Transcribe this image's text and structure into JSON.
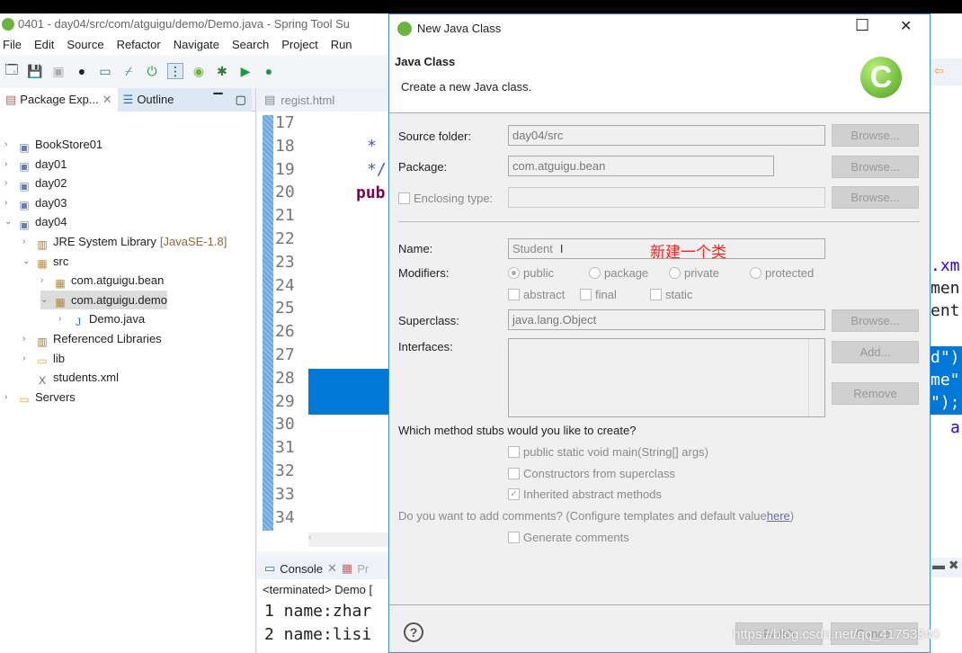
{
  "window": {
    "title": "0401 - day04/src/com/atguigu/demo/Demo.java - Spring Tool Su"
  },
  "menu": [
    "File",
    "Edit",
    "Source",
    "Refactor",
    "Navigate",
    "Search",
    "Project",
    "Run"
  ],
  "views": {
    "package_explorer": "Package Exp...",
    "outline": "Outline",
    "editor_tab1": "regist.html",
    "console": "Console",
    "console_other": "Pr"
  },
  "tree": [
    {
      "label": "BookStore01",
      "extra": "",
      "icon": "project-icon",
      "level": 0,
      "arrow": "›"
    },
    {
      "label": "day01",
      "extra": "",
      "icon": "project-icon",
      "level": 0,
      "arrow": "›"
    },
    {
      "label": "day02",
      "extra": "",
      "icon": "project-icon",
      "level": 0,
      "arrow": "›"
    },
    {
      "label": "day03",
      "extra": "",
      "icon": "project-icon",
      "level": 0,
      "arrow": "›"
    },
    {
      "label": "day04",
      "extra": "",
      "icon": "project-icon",
      "level": 0,
      "arrow": "⌄"
    },
    {
      "label": "JRE System Library",
      "extra": "[JavaSE-1.8]",
      "icon": "library-icon",
      "level": 1,
      "arrow": "›"
    },
    {
      "label": "src",
      "extra": "",
      "icon": "source-folder-icon",
      "level": 1,
      "arrow": "⌄"
    },
    {
      "label": "com.atguigu.bean",
      "extra": "",
      "icon": "package-icon",
      "level": 2,
      "arrow": "›"
    },
    {
      "label": "com.atguigu.demo",
      "extra": "",
      "icon": "package-icon",
      "level": 2,
      "arrow": "⌄",
      "selected": true
    },
    {
      "label": "Demo.java",
      "extra": "",
      "icon": "java-file-icon",
      "level": 3,
      "arrow": "›"
    },
    {
      "label": "Referenced Libraries",
      "extra": "",
      "icon": "library-icon",
      "level": 1,
      "arrow": "›"
    },
    {
      "label": "lib",
      "extra": "",
      "icon": "folder-icon",
      "level": 1,
      "arrow": "›"
    },
    {
      "label": "students.xml",
      "extra": "",
      "icon": "xml-file-icon",
      "level": 1,
      "arrow": ""
    },
    {
      "label": "Servers",
      "extra": "",
      "icon": "folder-icon",
      "level": 0,
      "arrow": "›"
    }
  ],
  "editor": {
    "line_numbers": [
      "17",
      "18",
      "19",
      "20",
      "21",
      "22",
      "23",
      "24",
      "25",
      "26",
      "27",
      "28",
      "29",
      "30",
      "31",
      "32",
      "33",
      "34"
    ],
    "code": {
      "l18": "*",
      "l19": "*/",
      "l20": "pub"
    },
    "right_code": [
      ".xm",
      "men",
      "ent",
      "d\")",
      "me\"",
      "\");",
      "a"
    ]
  },
  "console": {
    "status": "<terminated> Demo [",
    "lines": [
      "1 name:zhar",
      "2 name:lisi"
    ]
  },
  "dialog": {
    "title": "New Java Class",
    "heading": "Java Class",
    "description": "Create a new Java class.",
    "source_folder": {
      "label": "Source folder:",
      "value": "day04/src",
      "button": "Browse..."
    },
    "package": {
      "label": "Package:",
      "value": "com.atguigu.bean",
      "button": "Browse..."
    },
    "enclosing": {
      "label": "Enclosing type:",
      "value": "",
      "button": "Browse..."
    },
    "name": {
      "label": "Name:",
      "value": "Student",
      "annotation": "新建一个类"
    },
    "modifiers": {
      "label": "Modifiers:",
      "radios": [
        "public",
        "package",
        "private",
        "protected"
      ],
      "selected": "public",
      "checks": [
        "abstract",
        "final",
        "static"
      ]
    },
    "superclass": {
      "label": "Superclass:",
      "value": "java.lang.Object",
      "button": "Browse..."
    },
    "interfaces": {
      "label": "Interfaces:",
      "add": "Add...",
      "remove": "Remove"
    },
    "stubs": {
      "question": "Which method stubs would you like to create?",
      "options": [
        {
          "label": "public static void main(String[] args)",
          "checked": false
        },
        {
          "label": "Constructors from superclass",
          "checked": false
        },
        {
          "label": "Inherited abstract methods",
          "checked": true
        }
      ]
    },
    "comments": {
      "question": "Do you want to add comments? (Configure templates and default value ",
      "link": "here",
      "close": ")",
      "option": "Generate comments"
    },
    "finish": "Finish",
    "cancel": "Cancel"
  },
  "watermark": "https://blog.csdn.net/qq_41753340",
  "colors": {
    "selection": "#0078d7",
    "annotation": "#ff2020",
    "keyword": "#7f0055"
  }
}
